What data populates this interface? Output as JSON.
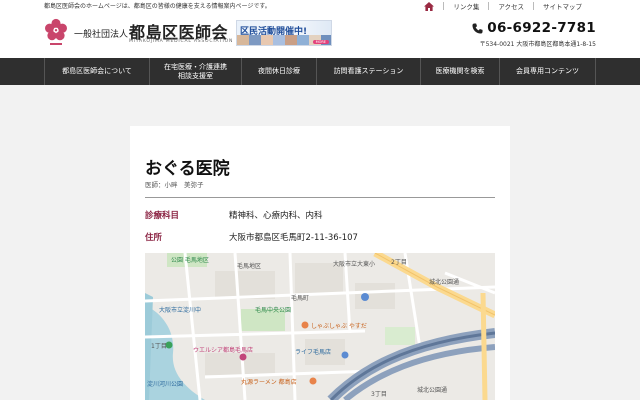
{
  "topbar": {
    "intro": "都島区医師会のホームページは、都島区の皆様の健康を支える情報案内ページです。",
    "links": [
      "リンク集",
      "アクセス",
      "サイトマップ"
    ]
  },
  "header": {
    "org_prefix": "一般社団法人",
    "org_name": "都島区医師会",
    "org_name_en": "MIYAKOJIMA MEDICAL ASSOCIATION",
    "banner_text": "区民活動開催中!",
    "banner_more": "MORE",
    "phone": "06-6922-7781",
    "address": "〒534-0021 大阪市都島区都島本通1-8-15"
  },
  "nav": {
    "items": [
      "都島区医師会について",
      "在宅医療・介護連携\n相談支援室",
      "夜間休日診療",
      "訪問看護ステーション",
      "医療機関を検索",
      "会員専用コンテンツ"
    ]
  },
  "clinic": {
    "name": "おぐる医院",
    "doctor": "医師：小畔　美弥子",
    "rows": [
      {
        "label": "診療科目",
        "value": "精神科、心療内科、内科"
      },
      {
        "label": "住所",
        "value": "大阪市都島区毛馬町2-11-36-107"
      }
    ]
  },
  "map": {
    "labels": [
      "公園 毛馬地区",
      "大阪市立大東小",
      "2丁目",
      "城北公園通",
      "毛馬町",
      "大阪市立淀川中",
      "毛馬中央公園",
      "しゃぶしゃぶ やすだ",
      "1丁目",
      "ウエルシア都島毛馬店",
      "ライフ毛馬店",
      "丸源ラーメン 都島店",
      "淀川河川公園",
      "毛馬地区",
      "3丁目",
      "城北公園通"
    ]
  },
  "colors": {
    "nav_bg": "#2f2f2f",
    "accent_label": "#8a2242",
    "banner_text": "#1f4d9a"
  }
}
